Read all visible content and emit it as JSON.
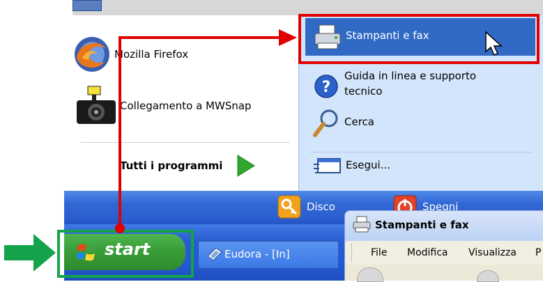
{
  "start_menu": {
    "left_items": [
      {
        "label": "Mozilla Firefox",
        "icon": "firefox-icon"
      },
      {
        "label": "Collegamento a MWSnap",
        "icon": "camera-icon"
      }
    ],
    "all_programs_label": "Tutti i programmi",
    "right_items": [
      {
        "label": "Stampanti e fax",
        "icon": "printer-icon"
      },
      {
        "label_line1": "Guida in linea e supporto",
        "label_line2": "tecnico",
        "icon": "help-icon"
      },
      {
        "label": "Cerca",
        "icon": "search-icon"
      },
      {
        "label": "Esegui...",
        "icon": "run-icon"
      }
    ],
    "bottom": {
      "logoff_label": "Disco",
      "shutdown_label": "Spegni computer"
    }
  },
  "taskbar": {
    "start_label": "start",
    "task_label": "Eudora - [In]"
  },
  "printers_window": {
    "title": "Stampanti e fax",
    "menu": [
      "File",
      "Modifica",
      "Visualizza",
      "P"
    ]
  },
  "annotation_colors": {
    "highlight_red": "#e00000",
    "highlight_green": "#14a34a"
  }
}
